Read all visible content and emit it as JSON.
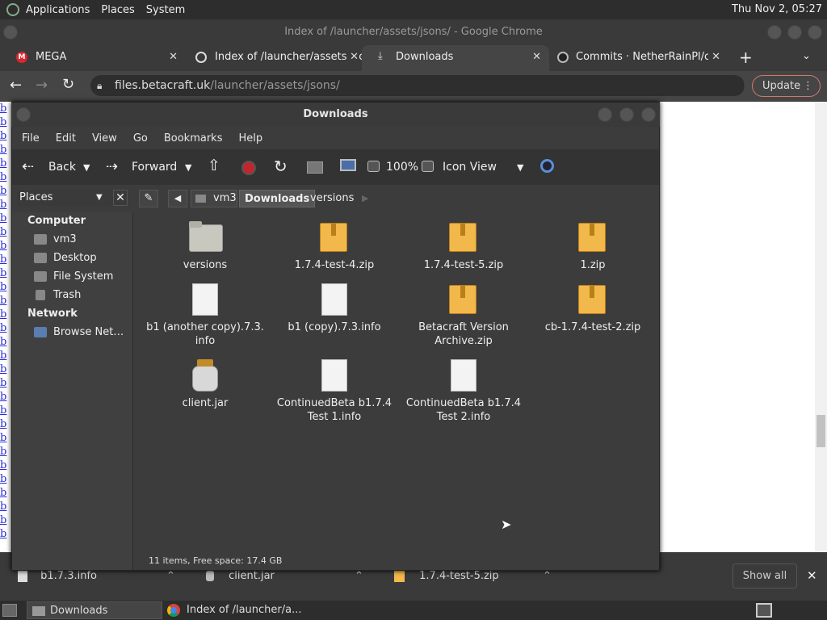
{
  "system_panel": {
    "menus": [
      "Applications",
      "Places",
      "System"
    ],
    "clock": "Thu Nov  2, 05:27"
  },
  "chrome": {
    "window_title": "Index of /launcher/assets/jsons/ - Google Chrome",
    "tabs": [
      {
        "label": "MEGA",
        "icon": "mega-icon",
        "close": "✕"
      },
      {
        "label": "Index of /launcher/assets/jsons/",
        "icon": "globe-icon",
        "close": "✕"
      },
      {
        "label": "Downloads",
        "icon": "download-icon",
        "close": "✕"
      },
      {
        "label": "Commits · NetherRainPl/c",
        "icon": "github-icon",
        "close": "✕"
      }
    ],
    "new_tab": "+",
    "url_host": "files.betacraft.uk",
    "url_path": "/launcher/assets/jsons/",
    "update_label": "Update",
    "page_links": "b"
  },
  "file_manager": {
    "title": "Downloads",
    "menu": [
      "File",
      "Edit",
      "View",
      "Go",
      "Bookmarks",
      "Help"
    ],
    "toolbar": {
      "back": "Back",
      "forward": "Forward",
      "zoom": "100%",
      "view_mode": "Icon View"
    },
    "side_pane_title": "Places",
    "breadcrumbs": [
      "vm3",
      "Downloads",
      "versions"
    ],
    "sidebar": {
      "computer_header": "Computer",
      "computer_items": [
        "vm3",
        "Desktop",
        "File System",
        "Trash"
      ],
      "network_header": "Network",
      "network_items": [
        "Browse Net…"
      ]
    },
    "files": [
      {
        "name": "versions",
        "kind": "folder"
      },
      {
        "name": "1.7.4-test-4.zip",
        "kind": "archive"
      },
      {
        "name": "1.7.4-test-5.zip",
        "kind": "archive"
      },
      {
        "name": "1.zip",
        "kind": "archive"
      },
      {
        "name": "b1 (another copy).7.3.\ninfo",
        "kind": "document"
      },
      {
        "name": "b1 (copy).7.3.info",
        "kind": "document"
      },
      {
        "name": "Betacraft Version\nArchive.zip",
        "kind": "archive"
      },
      {
        "name": "cb-1.7.4-test-2.zip",
        "kind": "archive"
      },
      {
        "name": "client.jar",
        "kind": "jar"
      },
      {
        "name": "ContinuedBeta b1.7.4\nTest 1.info",
        "kind": "document"
      },
      {
        "name": "ContinuedBeta b1.7.4\nTest 2.info",
        "kind": "document"
      }
    ],
    "status": "11 items, Free space: 17.4 GB"
  },
  "downloads_bar": {
    "items": [
      "b1.7.3.info",
      "client.jar",
      "1.7.4-test-5.zip"
    ],
    "show_all": "Show all",
    "close": "✕"
  },
  "taskbar": {
    "items": [
      "Downloads",
      "Index of /launcher/a..."
    ]
  },
  "colors": {
    "update_border": "#d07a6e",
    "link": "#2a2ad8",
    "archive": "#f2b84b"
  }
}
